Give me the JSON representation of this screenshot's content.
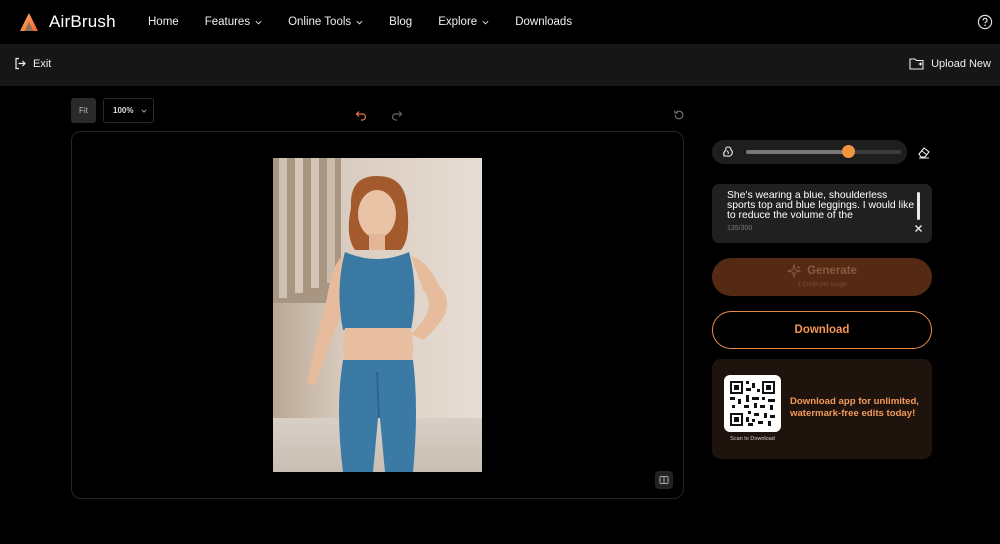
{
  "app": {
    "name": "AirBrush"
  },
  "nav": {
    "items": [
      {
        "label": "Home",
        "has_dropdown": false
      },
      {
        "label": "Features",
        "has_dropdown": true
      },
      {
        "label": "Online Tools",
        "has_dropdown": true
      },
      {
        "label": "Blog",
        "has_dropdown": false
      },
      {
        "label": "Explore",
        "has_dropdown": true
      },
      {
        "label": "Downloads",
        "has_dropdown": false
      }
    ],
    "help_icon": "question-circle-icon"
  },
  "subbar": {
    "exit_label": "Exit",
    "upload_label": "Upload New"
  },
  "canvas_toolbar": {
    "fit_label": "Fit",
    "zoom_value": "100%"
  },
  "brush": {
    "size_fraction": 0.66,
    "accent": "#f3943e"
  },
  "prompt": {
    "text": "She's wearing a blue, shoulderless sports top and blue leggings. I would like to reduce the volume of the",
    "counter": "135/300"
  },
  "generate": {
    "label": "Generate",
    "sub_label": "1 Credit per usage"
  },
  "download": {
    "label": "Download"
  },
  "promo": {
    "qr_caption": "Scan to Download",
    "text": "Download app for unlimited, watermark-free edits today!"
  },
  "colors": {
    "accent": "#f3943e",
    "download_border": "#e98a4a",
    "generate_bg": "#542a14"
  }
}
